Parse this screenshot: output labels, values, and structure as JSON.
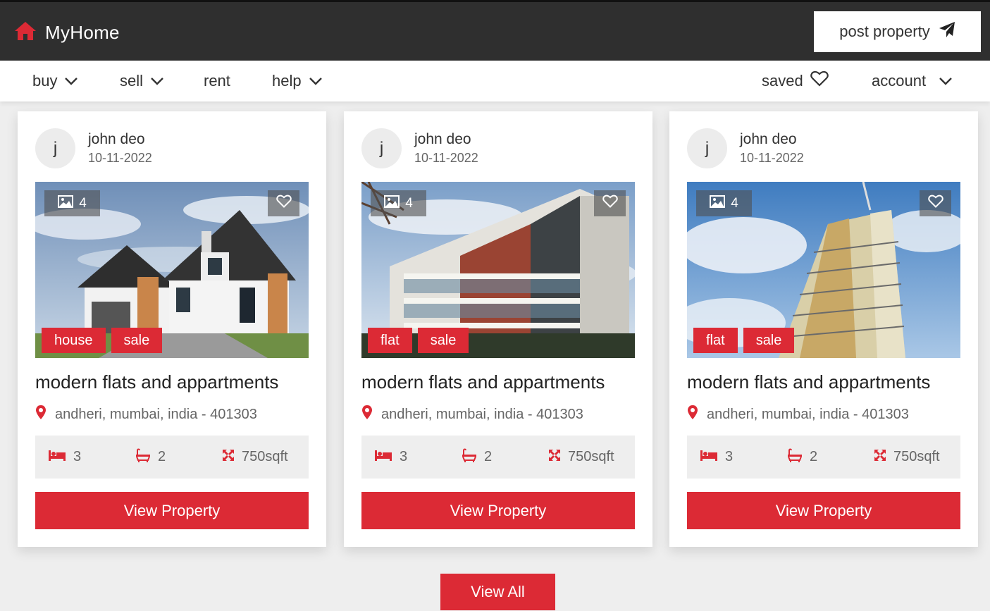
{
  "header": {
    "brand": "MyHome",
    "post_label": "post property",
    "icons": {
      "logo": "home-icon",
      "post": "paper-plane-icon"
    }
  },
  "nav": {
    "items": [
      {
        "label": "buy",
        "dropdown": true
      },
      {
        "label": "sell",
        "dropdown": true
      },
      {
        "label": "rent",
        "dropdown": false
      },
      {
        "label": "help",
        "dropdown": true
      }
    ],
    "saved_label": "saved",
    "account_label": "account"
  },
  "colors": {
    "accent": "#dc2a35",
    "header_bg": "#2f2f2f",
    "page_bg": "#eeeeee"
  },
  "cards": [
    {
      "avatar": "j",
      "user": "john deo",
      "date": "10-11-2022",
      "photo_count": "4",
      "photo": "house exterior",
      "tags": [
        "house",
        "sale"
      ],
      "title": "modern flats and appartments",
      "location": "andheri, mumbai, india - 401303",
      "beds": "3",
      "baths": "2",
      "area": "750sqft",
      "button": "View Property"
    },
    {
      "avatar": "j",
      "user": "john deo",
      "date": "10-11-2022",
      "photo_count": "4",
      "photo": "apartment building",
      "tags": [
        "flat",
        "sale"
      ],
      "title": "modern flats and appartments",
      "location": "andheri, mumbai, india - 401303",
      "beds": "3",
      "baths": "2",
      "area": "750sqft",
      "button": "View Property"
    },
    {
      "avatar": "j",
      "user": "john deo",
      "date": "10-11-2022",
      "photo_count": "4",
      "photo": "high-rise tower under construction",
      "tags": [
        "flat",
        "sale"
      ],
      "title": "modern flats and appartments",
      "location": "andheri, mumbai, india - 401303",
      "beds": "3",
      "baths": "2",
      "area": "750sqft",
      "button": "View Property"
    }
  ],
  "view_all_label": "View All"
}
